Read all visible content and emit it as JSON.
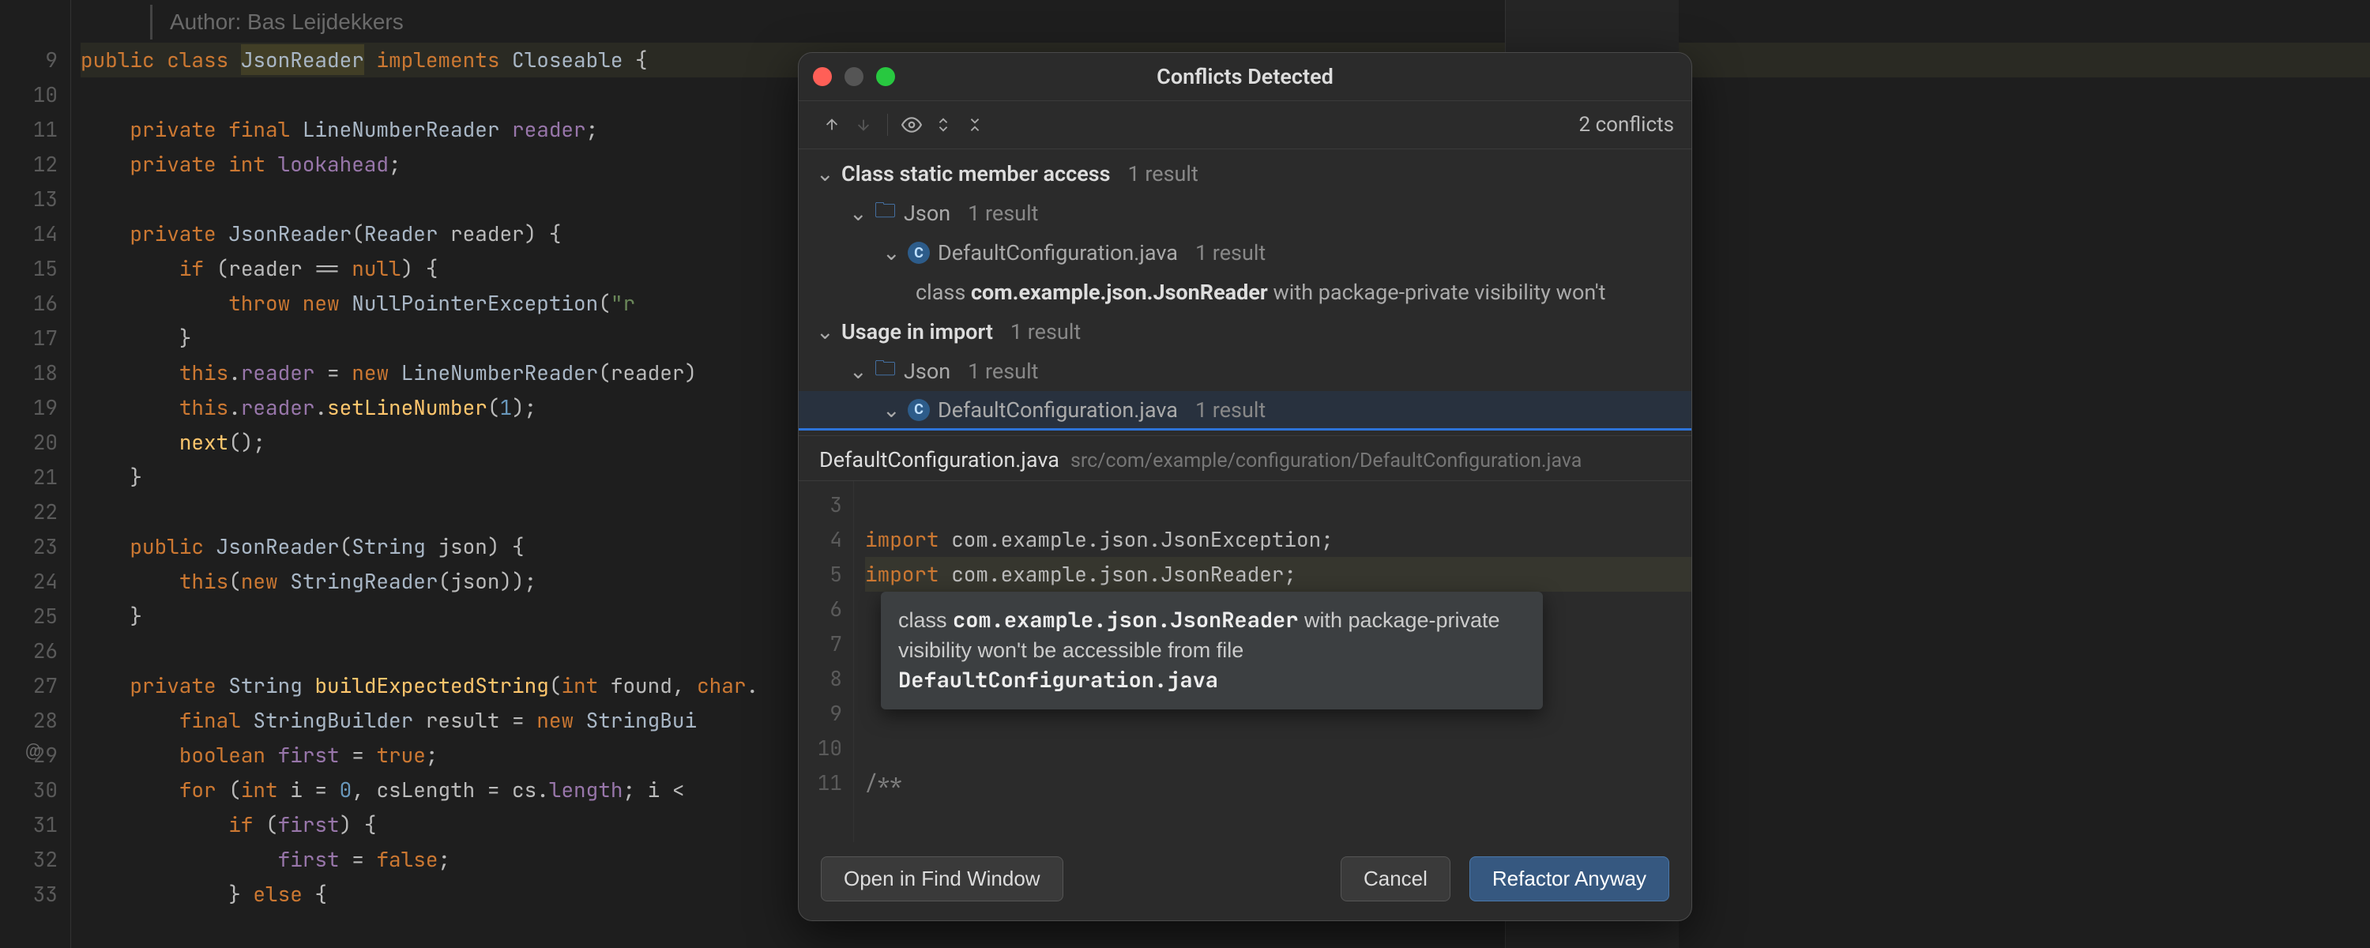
{
  "blame": {
    "label": "Author:  Bas Leijdekkers"
  },
  "gutter_lines": [
    "",
    "9",
    "10",
    "11",
    "12",
    "13",
    "14",
    "15",
    "16",
    "17",
    "18",
    "19",
    "20",
    "21",
    "22",
    "23",
    "24",
    "25",
    "26",
    "27",
    "28",
    "29",
    "30",
    "31",
    "32",
    "33"
  ],
  "dialog": {
    "title": "Conflicts Detected",
    "conflict_count": "2 conflicts",
    "sections": [
      {
        "heading": "Class static member access",
        "heading_meta": "1 result",
        "pkg": "Json",
        "pkg_meta": "1 result",
        "file": "DefaultConfiguration.java",
        "file_meta": "1 result",
        "desc_prefix": "class ",
        "desc_strong": "com.example.json.JsonReader",
        "desc_suffix": " with package-private visibility won't"
      },
      {
        "heading": "Usage in import",
        "heading_meta": "1 result",
        "pkg": "Json",
        "pkg_meta": "1 result",
        "file": "DefaultConfiguration.java",
        "file_meta": "1 result"
      }
    ],
    "preview": {
      "file": "DefaultConfiguration.java",
      "path": "src/com/example/configuration/DefaultConfiguration.java",
      "gutter": [
        "3",
        "4",
        "5",
        "6",
        "7",
        "8",
        "9",
        "10",
        "11"
      ]
    },
    "tooltip": {
      "pre": "class ",
      "code1": "com.example.json.JsonReader",
      "mid": " with package-private visibility won't be accessible from file ",
      "code2": "DefaultConfiguration.java"
    },
    "buttons": {
      "open": "Open in Find Window",
      "cancel": "Cancel",
      "refactor": "Refactor Anyway"
    }
  },
  "code": {
    "l1": "",
    "l2_a": "public class ",
    "l2_b": "JsonReader",
    "l2_c": " implements ",
    "l2_d": "Closeable {",
    "l3": "",
    "l4": "    private final LineNumberReader reader;",
    "l5": "    private int lookahead;",
    "l6": "",
    "l7": "    private JsonReader(Reader reader) {",
    "l8": "        if (reader == null) {",
    "l9": "            throw new NullPointerException(\"r",
    "l10": "        }",
    "l11": "        this.reader = new LineNumberReader(reader)",
    "l12": "        this.reader.setLineNumber(1);",
    "l13": "        next();",
    "l14": "    }",
    "l15": "",
    "l16": "    public JsonReader(String json) {",
    "l17": "        this(new StringReader(json));",
    "l18": "    }",
    "l19": "",
    "l20": "    private String buildExpectedString(int found, char.",
    "l21": "        final StringBuilder result = new StringBui",
    "l22": "        boolean first = true;",
    "l23": "        for (int i = 0, csLength = cs.length; i <",
    "l24": "            if (first) {",
    "l25": "                first = false;",
    "l26": "            } else {"
  },
  "preview_code": {
    "l1": "",
    "l2": "import com.example.json.JsonException;",
    "l3": "import com.example.json.JsonReader;",
    "l9": "/**"
  }
}
